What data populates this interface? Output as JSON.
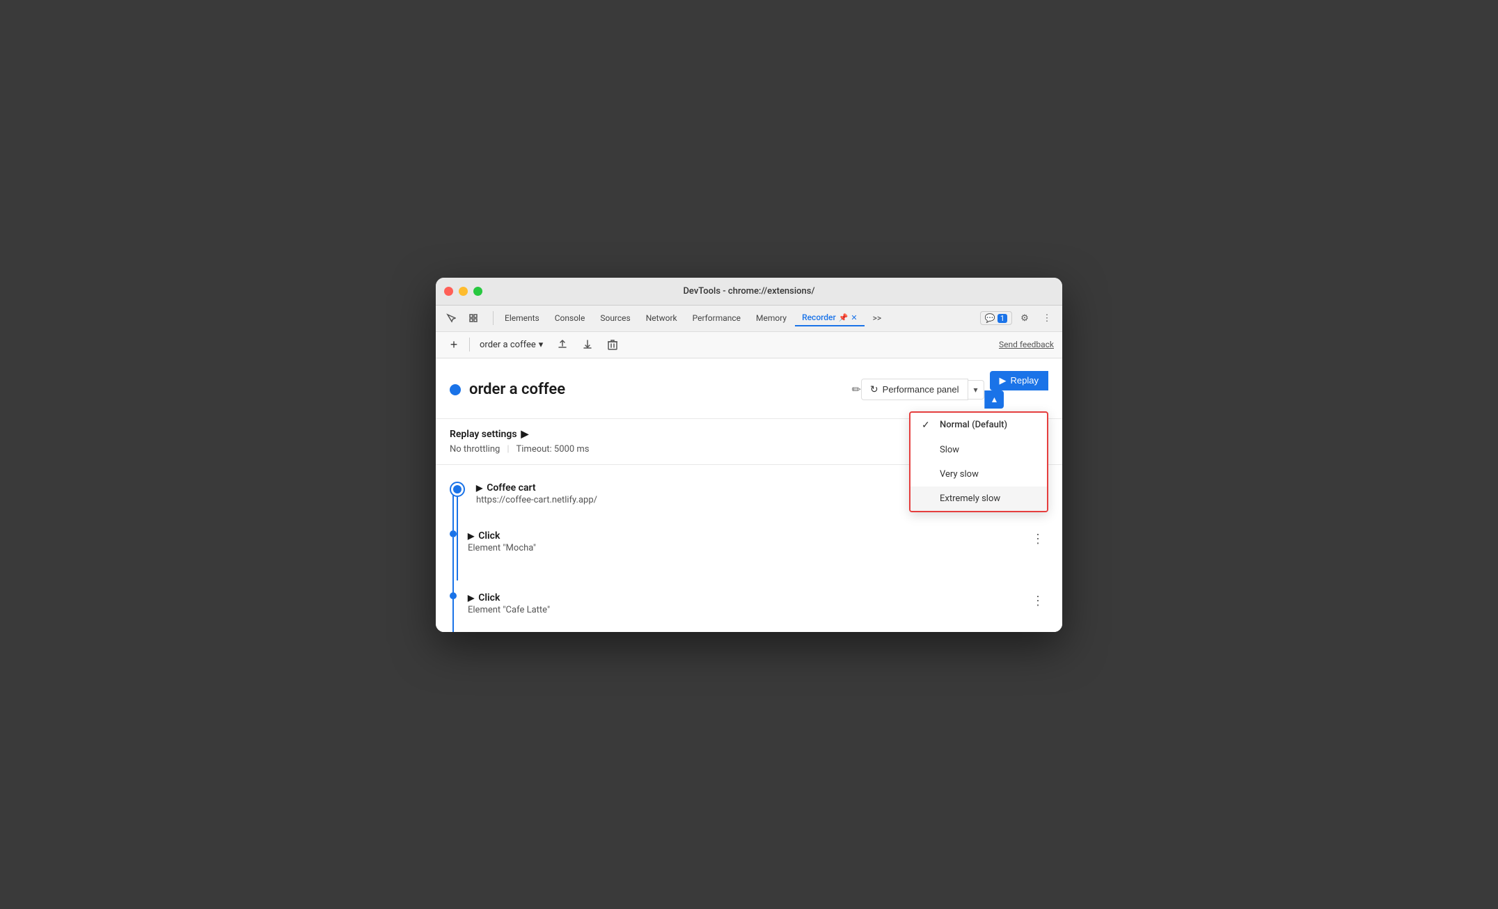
{
  "window": {
    "title": "DevTools - chrome://extensions/"
  },
  "tabbar": {
    "tabs": [
      {
        "id": "elements",
        "label": "Elements",
        "active": false
      },
      {
        "id": "console",
        "label": "Console",
        "active": false
      },
      {
        "id": "sources",
        "label": "Sources",
        "active": false
      },
      {
        "id": "network",
        "label": "Network",
        "active": false
      },
      {
        "id": "performance",
        "label": "Performance",
        "active": false
      },
      {
        "id": "memory",
        "label": "Memory",
        "active": false
      },
      {
        "id": "recorder",
        "label": "Recorder",
        "active": true
      }
    ],
    "more_tabs_label": ">>",
    "chat_badge": "1",
    "settings_icon": "⚙",
    "more_icon": "⋮"
  },
  "toolbar": {
    "add_label": "+",
    "recording_name": "order a coffee",
    "dropdown_icon": "▾",
    "export_icon": "↑",
    "download_icon": "↓",
    "delete_icon": "🗑",
    "send_feedback_label": "Send feedback"
  },
  "recording_header": {
    "title": "order a coffee",
    "edit_icon": "✏",
    "perf_panel_label": "Performance panel",
    "perf_panel_icon": "↻",
    "replay_label": "Replay"
  },
  "dropdown_menu": {
    "items": [
      {
        "id": "normal",
        "label": "Normal (Default)",
        "selected": true
      },
      {
        "id": "slow",
        "label": "Slow",
        "selected": false
      },
      {
        "id": "very_slow",
        "label": "Very slow",
        "selected": false
      },
      {
        "id": "extremely_slow",
        "label": "Extremely slow",
        "selected": false
      }
    ]
  },
  "replay_settings": {
    "title": "Replay settings",
    "expand_icon": "▶",
    "throttling": "No throttling",
    "timeout": "Timeout: 5000 ms"
  },
  "steps": [
    {
      "id": "coffee-cart",
      "type": "navigate",
      "title": "Coffee cart",
      "subtitle": "https://coffee-cart.netlify.app/",
      "has_outer_circle": true
    },
    {
      "id": "click-mocha",
      "type": "click",
      "title": "Click",
      "subtitle": "Element \"Mocha\"",
      "has_outer_circle": false
    },
    {
      "id": "click-latte",
      "type": "click",
      "title": "Click",
      "subtitle": "Element \"Cafe Latte\"",
      "has_outer_circle": false
    }
  ],
  "colors": {
    "blue": "#1a73e8",
    "red_border": "#e53e3e",
    "timeline_blue": "#1a73e8"
  }
}
